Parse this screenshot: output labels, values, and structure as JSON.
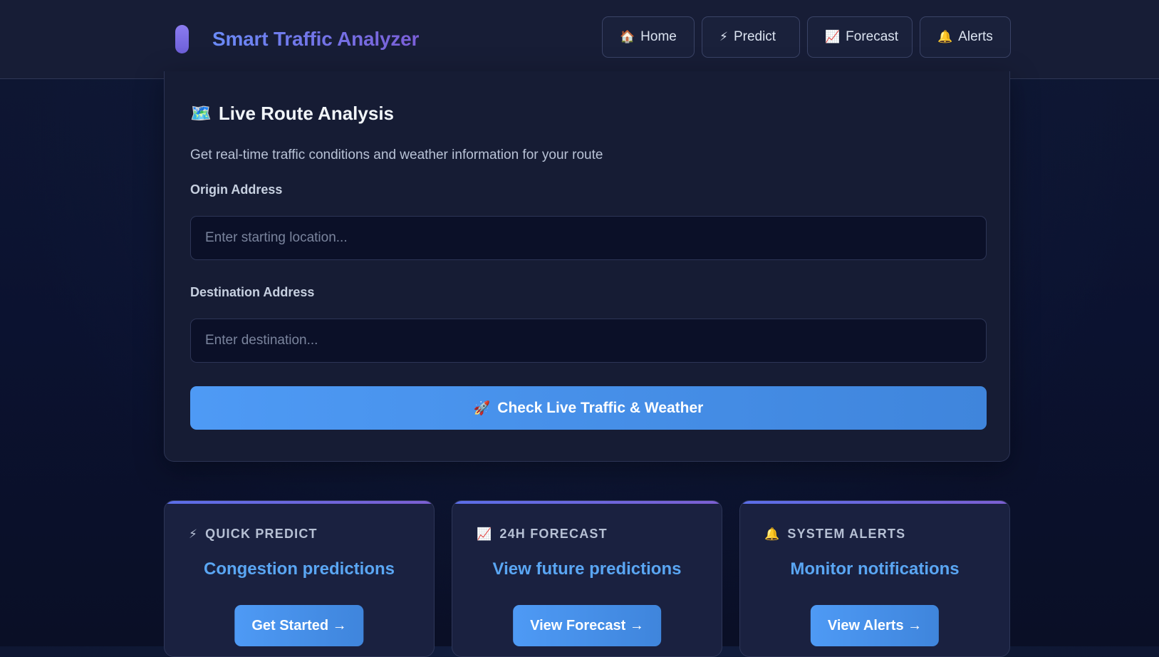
{
  "header": {
    "title": "Smart Traffic Analyzer",
    "nav": [
      {
        "icon": "house-icon",
        "glyph": "🏠",
        "label": "Home"
      },
      {
        "icon": "lightning-icon",
        "glyph": "⚡",
        "label": "Predict"
      },
      {
        "icon": "chart-increasing-icon",
        "glyph": "📈",
        "label": "Forecast"
      },
      {
        "icon": "bell-icon",
        "glyph": "🔔",
        "label": "Alerts"
      }
    ]
  },
  "route": {
    "icon": "map-icon",
    "glyph": "🗺️",
    "title": "Live Route Analysis",
    "subtitle": "Get real-time traffic conditions and weather information for your route",
    "origin_label": "Origin Address",
    "origin_placeholder": "Enter starting location...",
    "origin_value": "",
    "destination_label": "Destination Address",
    "destination_placeholder": "Enter destination...",
    "destination_value": "",
    "cta_icon": "rocket-icon",
    "cta_glyph": "🚀",
    "cta_label": "Check Live Traffic & Weather"
  },
  "features": [
    {
      "icon": "lightning-icon",
      "glyph": "⚡",
      "heading": "QUICK PREDICT",
      "title": "Congestion predictions",
      "button": "Get Started →"
    },
    {
      "icon": "chart-increasing-icon",
      "glyph": "📈",
      "heading": "24H FORECAST",
      "title": "View future predictions",
      "button": "View Forecast →"
    },
    {
      "icon": "bell-icon",
      "glyph": "🔔",
      "heading": "SYSTEM ALERTS",
      "title": "Monitor notifications",
      "button": "View Alerts →"
    }
  ],
  "colors": {
    "background": "#0b1230",
    "header": "#171d36",
    "accent_blue": "#4e9af5",
    "brand_purple": "#7b5fd8",
    "feature_title": "#5aa6f3"
  }
}
